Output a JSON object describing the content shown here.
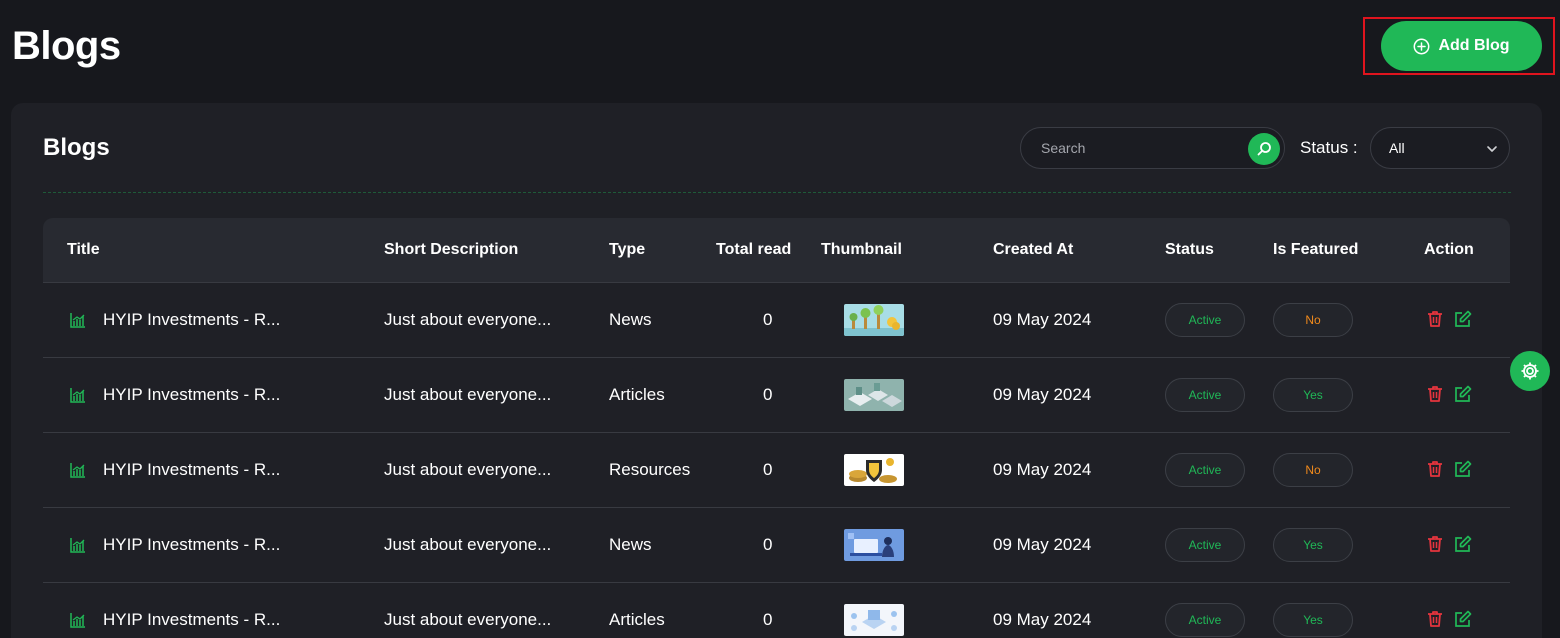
{
  "page": {
    "title": "Blogs",
    "add_button_label": "Add Blog"
  },
  "card": {
    "title": "Blogs",
    "search_placeholder": "Search",
    "status_label": "Status :",
    "status_selected": "All"
  },
  "table": {
    "headers": {
      "title": "Title",
      "short_description": "Short Description",
      "type": "Type",
      "total_read": "Total read",
      "thumbnail": "Thumbnail",
      "created_at": "Created At",
      "status": "Status",
      "is_featured": "Is Featured",
      "action": "Action"
    },
    "rows": [
      {
        "title": "HYIP Investments - R...",
        "short_description": "Just about everyone...",
        "type": "News",
        "total_read": "0",
        "thumbnail": "plants-coins-thumbnail",
        "created_at": "09 May 2024",
        "status": "Active",
        "is_featured": "No"
      },
      {
        "title": "HYIP Investments - R...",
        "short_description": "Just about everyone...",
        "type": "Articles",
        "total_read": "0",
        "thumbnail": "isometric-city-thumbnail",
        "created_at": "09 May 2024",
        "status": "Active",
        "is_featured": "Yes"
      },
      {
        "title": "HYIP Investments - R...",
        "short_description": "Just about everyone...",
        "type": "Resources",
        "total_read": "0",
        "thumbnail": "gold-shield-thumbnail",
        "created_at": "09 May 2024",
        "status": "Active",
        "is_featured": "No"
      },
      {
        "title": "HYIP Investments - R...",
        "short_description": "Just about everyone...",
        "type": "News",
        "total_read": "0",
        "thumbnail": "person-laptop-thumbnail",
        "created_at": "09 May 2024",
        "status": "Active",
        "is_featured": "Yes"
      },
      {
        "title": "HYIP Investments - R...",
        "short_description": "Just about everyone...",
        "type": "Articles",
        "total_read": "0",
        "thumbnail": "blue-tech-thumbnail",
        "created_at": "09 May 2024",
        "status": "Active",
        "is_featured": "Yes"
      }
    ]
  },
  "colors": {
    "background": "#17181d",
    "card": "#1f2026",
    "accent": "#20b857",
    "warning": "#f08a1c",
    "danger": "#e5343e",
    "highlight_frame": "#e0141e"
  },
  "icons": {
    "add": "plus-circle-icon",
    "search": "search-icon",
    "select": "chevron-down-icon",
    "title": "chart-icon",
    "delete": "trash-icon",
    "edit": "edit-icon",
    "settings": "gear-icon"
  }
}
